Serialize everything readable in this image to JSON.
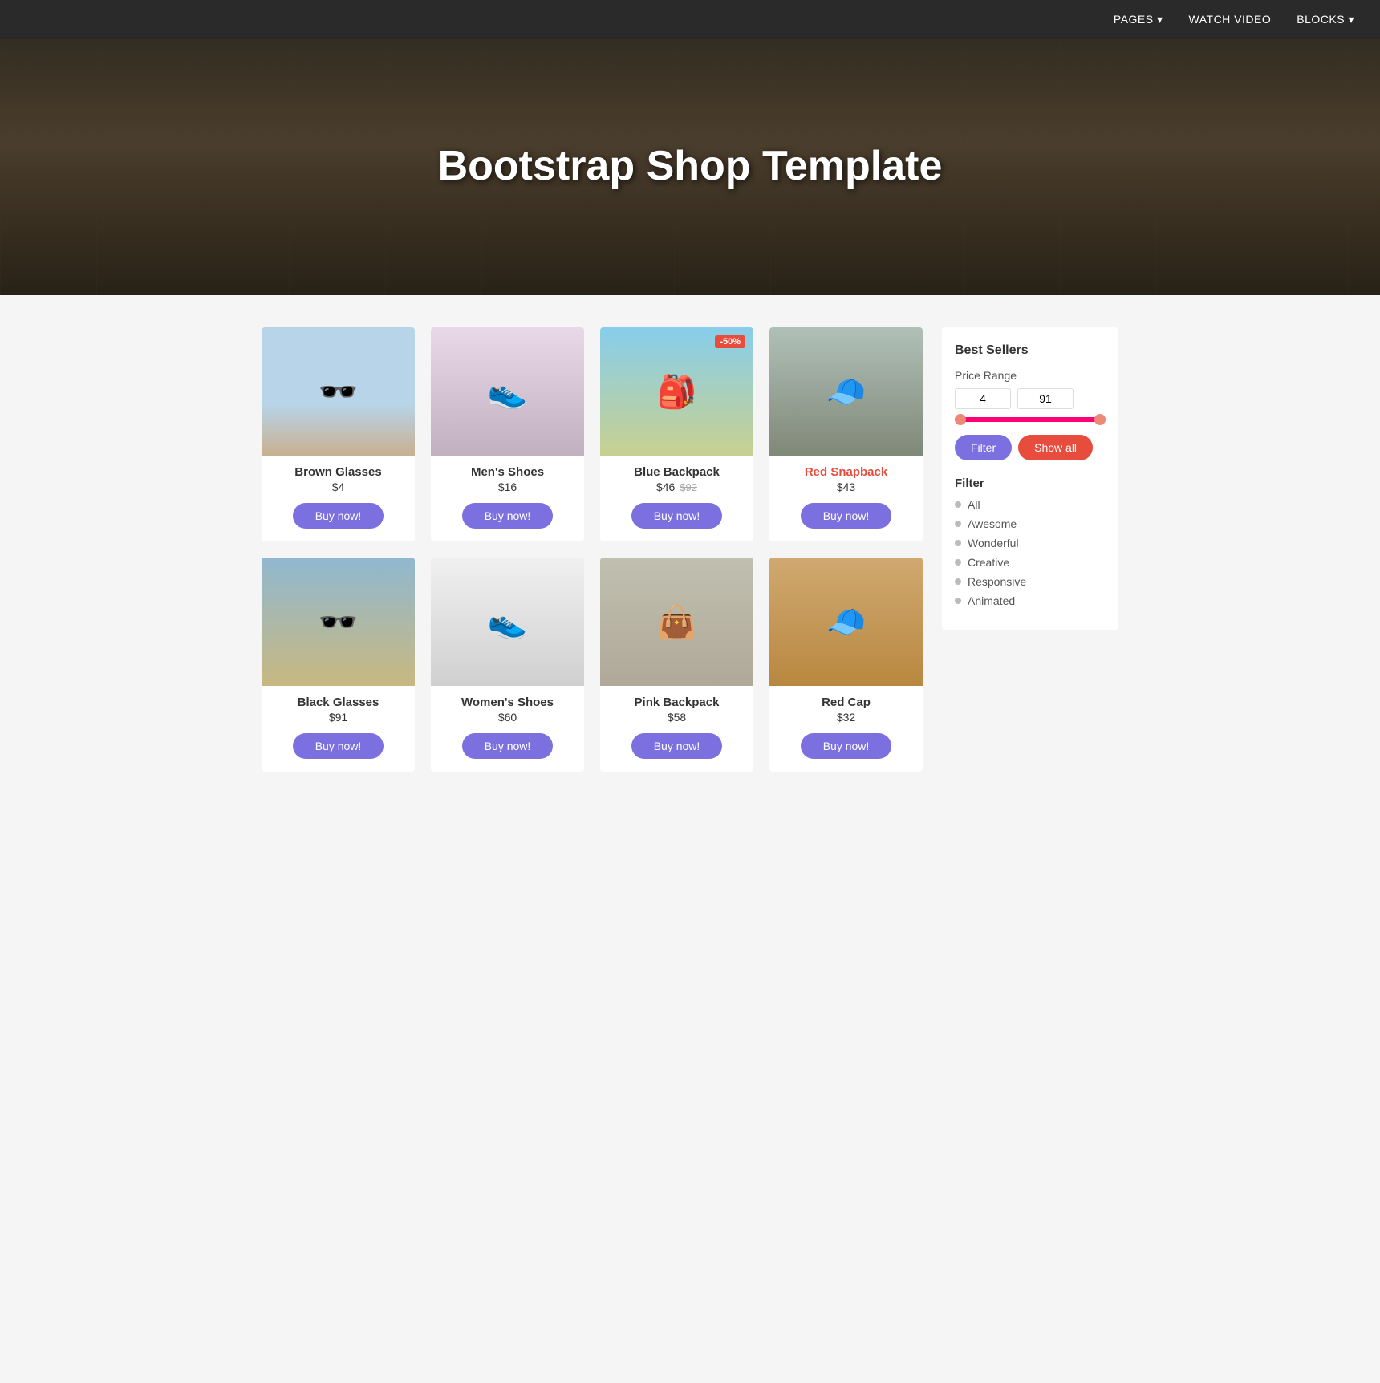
{
  "nav": {
    "items": [
      {
        "label": "PAGES",
        "hasArrow": true
      },
      {
        "label": "WATCH VIDEO",
        "hasArrow": false
      },
      {
        "label": "BLOCKS",
        "hasArrow": true
      }
    ]
  },
  "hero": {
    "title": "Bootstrap Shop Template"
  },
  "products": [
    {
      "id": "brown-glasses",
      "name": "Brown Glasses",
      "price": "$4",
      "priceOriginal": null,
      "sale": null,
      "buyLabel": "Buy now!",
      "nameColor": "normal",
      "imgClass": "img-brown-glasses",
      "emoji": "🕶️"
    },
    {
      "id": "mens-shoes",
      "name": "Men's Shoes",
      "price": "$16",
      "priceOriginal": null,
      "sale": null,
      "buyLabel": "Buy now!",
      "nameColor": "normal",
      "imgClass": "img-mens-shoes",
      "emoji": "👟"
    },
    {
      "id": "blue-backpack",
      "name": "Blue Backpack",
      "price": "$46",
      "priceOriginal": "$92",
      "sale": "-50%",
      "buyLabel": "Buy now!",
      "nameColor": "normal",
      "imgClass": "img-blue-backpack",
      "emoji": "🎒"
    },
    {
      "id": "red-snapback",
      "name": "Red Snapback",
      "price": "$43",
      "priceOriginal": null,
      "sale": null,
      "buyLabel": "Buy now!",
      "nameColor": "red",
      "imgClass": "img-red-snapback",
      "emoji": "🧢"
    },
    {
      "id": "black-glasses",
      "name": "Black Glasses",
      "price": "$91",
      "priceOriginal": null,
      "sale": null,
      "buyLabel": "Buy now!",
      "nameColor": "normal",
      "imgClass": "img-black-glasses",
      "emoji": "🕶️"
    },
    {
      "id": "womens-shoes",
      "name": "Women's Shoes",
      "price": "$60",
      "priceOriginal": null,
      "sale": null,
      "buyLabel": "Buy now!",
      "nameColor": "normal",
      "imgClass": "img-womens-shoes",
      "emoji": "👟"
    },
    {
      "id": "pink-backpack",
      "name": "Pink Backpack",
      "price": "$58",
      "priceOriginal": null,
      "sale": null,
      "buyLabel": "Buy now!",
      "nameColor": "normal",
      "imgClass": "img-pink-backpack",
      "emoji": "👜"
    },
    {
      "id": "red-cap",
      "name": "Red Cap",
      "price": "$32",
      "priceOriginal": null,
      "sale": null,
      "buyLabel": "Buy now!",
      "nameColor": "normal",
      "imgClass": "img-red-cap",
      "emoji": "🧢"
    }
  ],
  "sidebar": {
    "bestsellers_label": "Best Sellers",
    "price_range_label": "Price Range",
    "price_min": "4",
    "price_max": "91",
    "btn_filter": "Filter",
    "btn_show_all": "Show all",
    "filter_label": "Filter",
    "filter_items": [
      {
        "label": "All"
      },
      {
        "label": "Awesome"
      },
      {
        "label": "Wonderful"
      },
      {
        "label": "Creative"
      },
      {
        "label": "Responsive"
      },
      {
        "label": "Animated"
      }
    ]
  }
}
